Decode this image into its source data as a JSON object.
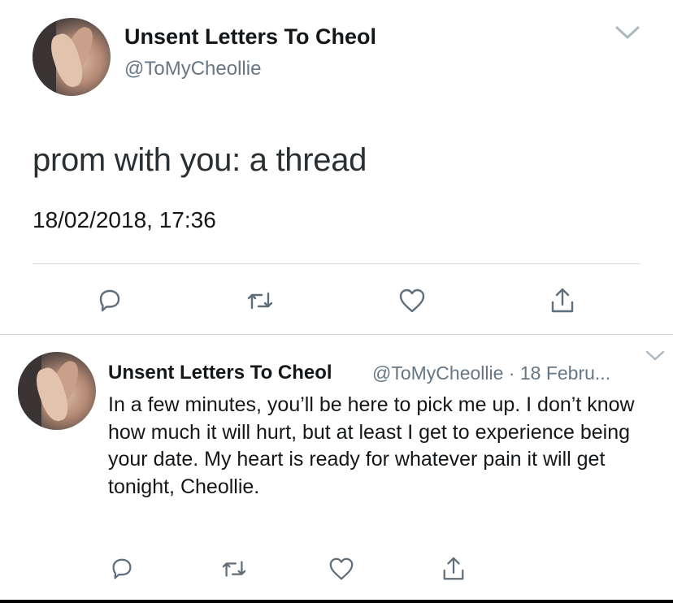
{
  "main_tweet": {
    "display_name": "Unsent Letters To Cheol",
    "handle": "@ToMyCheollie",
    "text": "prom with you: a thread",
    "timestamp": "18/02/2018, 17:36"
  },
  "reply_tweet": {
    "display_name": "Unsent Letters To Cheol",
    "handle": "@ToMyCheollie",
    "separator": "·",
    "date": "18 Febru...",
    "text": "In a few minutes, you’ll be here to pick me up. I don’t know how much it will hurt, but at least I get to experience being your date. My heart is ready for whatever pain it will get tonight, Cheollie."
  },
  "icons": {
    "reply": "reply-icon",
    "retweet": "retweet-icon",
    "like": "heart-icon",
    "share": "share-icon",
    "menu": "chevron-down-icon"
  },
  "colors": {
    "text": "#14171a",
    "secondary": "#657786",
    "icon": "#5f6e7b",
    "divider": "#d8dde1"
  }
}
